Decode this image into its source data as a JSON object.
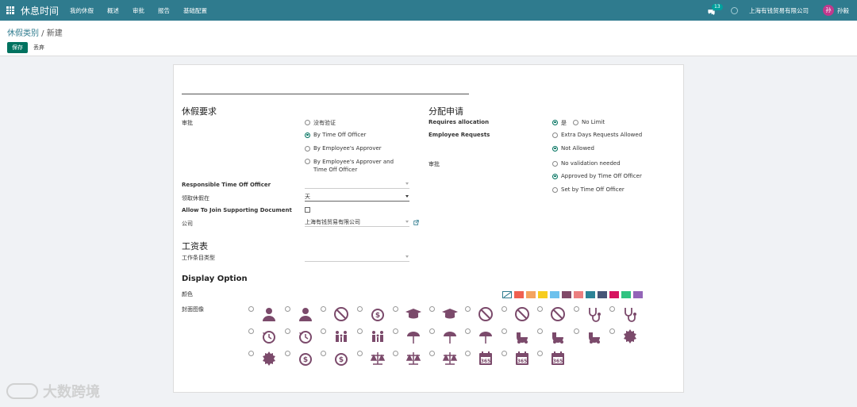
{
  "topbar": {
    "app_title": "休息时间",
    "menu": [
      "我的休假",
      "概述",
      "审批",
      "报告",
      "基础配置"
    ],
    "chat_count": "13",
    "company": "上海有钱贸易有限公司",
    "avatar_initial": "孙",
    "user_name": "孙毅"
  },
  "control": {
    "breadcrumb_parent": "休假类别",
    "breadcrumb_sep": " / ",
    "breadcrumb_current": "新建",
    "save_label": "保存",
    "discard_label": "丢弃"
  },
  "form": {
    "section_requests": "休假要求",
    "section_allocation": "分配申请",
    "section_payroll": "工资表",
    "section_display": "Display Option",
    "approval_label": "审批",
    "approval_options": [
      {
        "label": "没有验证",
        "checked": false
      },
      {
        "label": "By Time Off Officer",
        "checked": true
      },
      {
        "label": "By Employee's Approver",
        "checked": false
      },
      {
        "label": "By Employee's Approver and Time Off Officer",
        "checked": false
      }
    ],
    "responsible_label": "Responsible Time Off Officer",
    "responsible_value": "",
    "take_in_label": "领取休假在",
    "take_in_value": "天",
    "supporting_doc_label": "Allow To Join Supporting Document",
    "company_label": "公司",
    "company_value": "上海有钱贸易有限公司",
    "requires_allocation_label": "Requires allocation",
    "requires_allocation_options": [
      {
        "label": "是",
        "checked": true
      },
      {
        "label": "No Limit",
        "checked": false
      }
    ],
    "employee_requests_label": "Employee Requests",
    "employee_requests_options": [
      {
        "label": "Extra Days Requests Allowed",
        "checked": false
      },
      {
        "label": "Not Allowed",
        "checked": true
      }
    ],
    "allocation_approval_label": "审批",
    "allocation_approval_options": [
      {
        "label": "No validation needed",
        "checked": false
      },
      {
        "label": "Approved by Time Off Officer",
        "checked": true
      },
      {
        "label": "Set by Time Off Officer",
        "checked": false
      }
    ],
    "work_entry_label": "工作条目类型",
    "color_label": "颜色",
    "cover_label": "封面图像",
    "colors": [
      "#ffffff",
      "#f06050",
      "#f4a460",
      "#f7cd1f",
      "#6cc1ed",
      "#814968",
      "#eb7e7f",
      "#2c8397",
      "#475577",
      "#d6145f",
      "#30c381",
      "#9365b8"
    ],
    "icon_color": "#7b4a6b",
    "cover_icons": [
      "user-presentation-icon",
      "user-outline-icon",
      "no-smoking-icon",
      "dollar-circle-icon",
      "graduation-cap-icon",
      "graduation-cap-outline-icon",
      "no-handicap-icon",
      "no-sign-icon",
      "no-sign-outline-icon",
      "stethoscope-icon",
      "stethoscope-outline-icon",
      "history-icon",
      "history-outline-icon",
      "family-icon",
      "family-outline-icon",
      "beach-umbrella-icon",
      "beach-umbrella-half-icon",
      "beach-umbrella-outline-icon",
      "stroller-icon",
      "stroller-half-icon",
      "stroller-outline-icon",
      "badge-burst-icon",
      "badge-burst-outline-icon",
      "money-bag-icon",
      "money-bag-outline-icon",
      "scales-icon",
      "scales-half-icon",
      "scales-outline-icon",
      "calendar-365-outline-icon",
      "calendar-365-icon",
      "calendar-365-half-icon"
    ],
    "calendar_text": "365"
  },
  "watermark": "大数跨境"
}
